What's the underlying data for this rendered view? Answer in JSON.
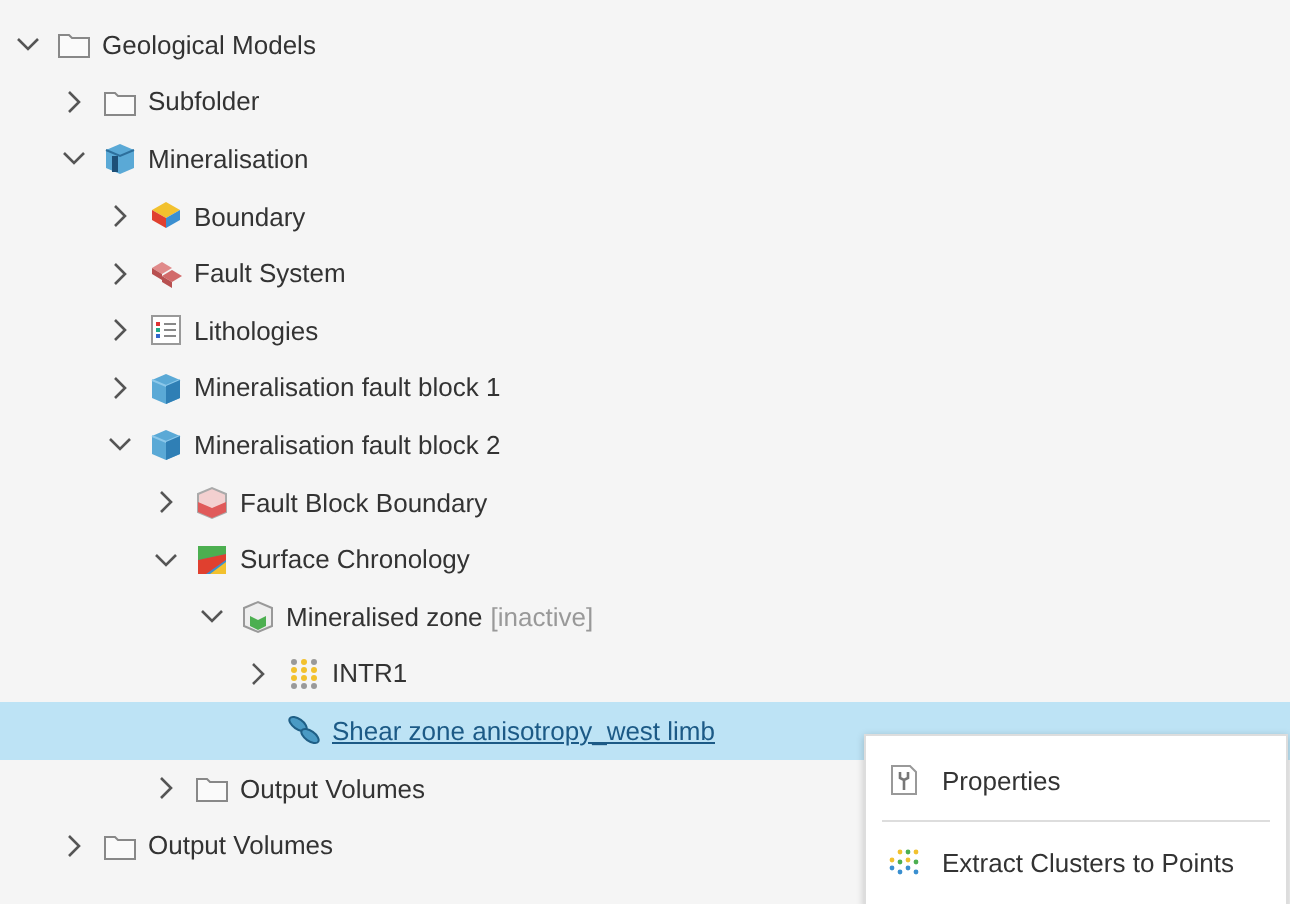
{
  "tree": [
    {
      "label": "Geological Models",
      "kind": "folder",
      "expanded": true,
      "selected": false,
      "children": [
        {
          "label": "Subfolder",
          "kind": "folder",
          "expanded": false,
          "selected": false
        },
        {
          "label": "Mineralisation",
          "kind": "model",
          "expanded": true,
          "selected": false,
          "children": [
            {
              "label": "Boundary",
              "kind": "boundary",
              "expanded": false,
              "selected": false
            },
            {
              "label": "Fault System",
              "kind": "fault",
              "expanded": false,
              "selected": false
            },
            {
              "label": "Lithologies",
              "kind": "lithology",
              "expanded": false,
              "selected": false
            },
            {
              "label": "Mineralisation fault block 1",
              "kind": "block",
              "expanded": false,
              "selected": false
            },
            {
              "label": "Mineralisation fault block 2",
              "kind": "block",
              "expanded": true,
              "selected": false,
              "children": [
                {
                  "label": "Fault Block Boundary",
                  "kind": "faultblock",
                  "expanded": false,
                  "selected": false
                },
                {
                  "label": "Surface Chronology",
                  "kind": "chronology",
                  "expanded": true,
                  "selected": false,
                  "children": [
                    {
                      "label": "Mineralised zone",
                      "note": "[inactive]",
                      "kind": "zone",
                      "expanded": true,
                      "selected": false,
                      "children": [
                        {
                          "label": "INTR1",
                          "kind": "points",
                          "expanded": false,
                          "selected": false
                        },
                        {
                          "label": "Shear zone anisotropy_west limb",
                          "kind": "anisotropy",
                          "selected": true
                        }
                      ]
                    }
                  ]
                },
                {
                  "label": "Output Volumes",
                  "kind": "folder",
                  "expanded": false,
                  "selected": false
                }
              ]
            }
          ]
        },
        {
          "label": "Output Volumes",
          "kind": "folder",
          "expanded": false,
          "selected": false
        }
      ]
    }
  ],
  "context_menu": {
    "items": [
      {
        "label": "Properties",
        "kind": "properties"
      },
      {
        "label": "Extract Clusters to Points",
        "kind": "clusters"
      }
    ]
  }
}
